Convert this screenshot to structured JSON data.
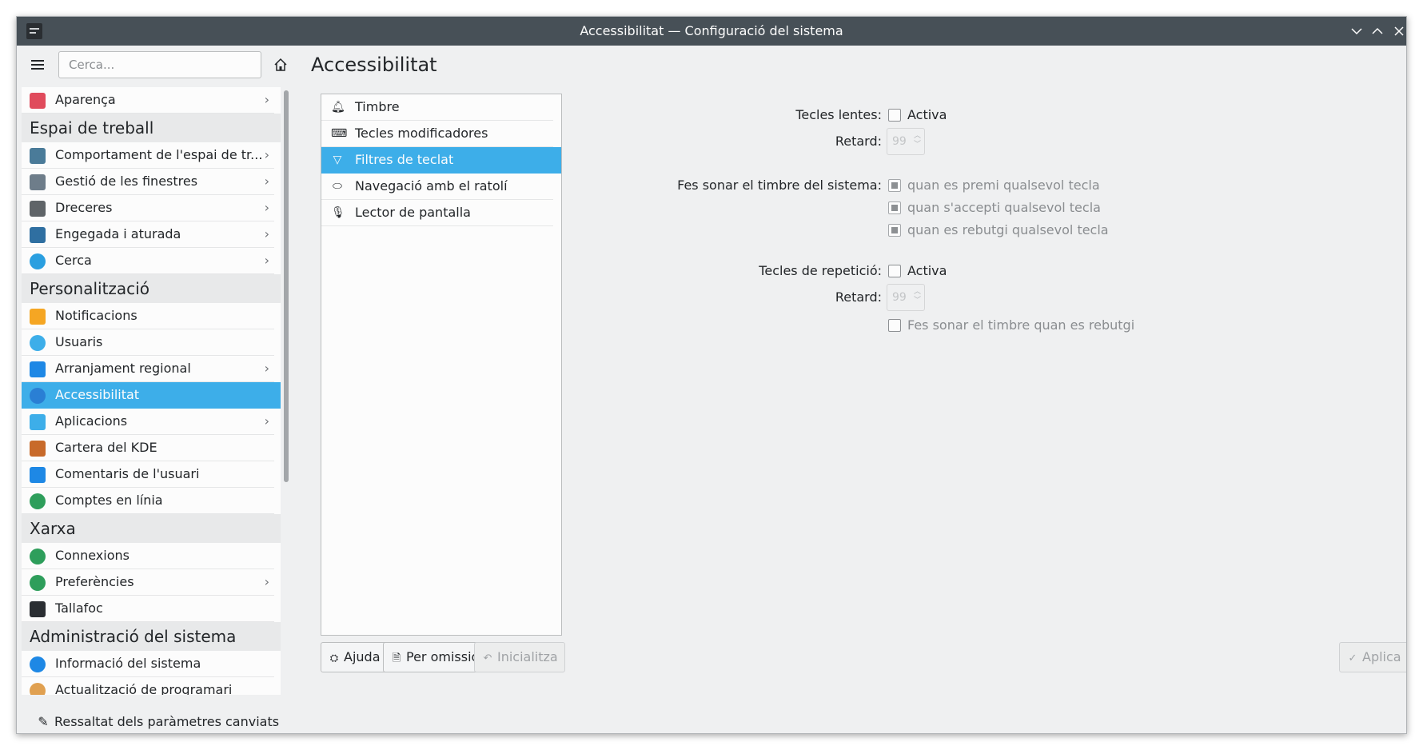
{
  "window": {
    "title": "Accessibilitat — Configuració del sistema",
    "controls": [
      "minimize",
      "maximize",
      "close"
    ]
  },
  "sidebar": {
    "search_placeholder": "Cerca...",
    "items": [
      {
        "label": "Aparença",
        "icon": "appearance-icon",
        "color": "#e04b5c",
        "chevron": true
      },
      {
        "header": "Espai de treball"
      },
      {
        "label": "Comportament de l'espai de tr...",
        "icon": "workspace-behavior-icon",
        "color": "#4a7b99",
        "chevron": true
      },
      {
        "label": "Gestió de les finestres",
        "icon": "window-management-icon",
        "color": "#6e7d8a",
        "chevron": true
      },
      {
        "label": "Dreceres",
        "icon": "keyboard-icon",
        "color": "#5f6468",
        "chevron": true
      },
      {
        "label": "Engegada i aturada",
        "icon": "startup-icon",
        "color": "#2f6fa1",
        "chevron": true
      },
      {
        "label": "Cerca",
        "icon": "search-icon",
        "color": "#2a9fe0",
        "chevron": true
      },
      {
        "header": "Personalització"
      },
      {
        "label": "Notificacions",
        "icon": "bell-icon",
        "color": "#f5a623",
        "chevron": false
      },
      {
        "label": "Usuaris",
        "icon": "users-icon",
        "color": "#3daee9",
        "chevron": false
      },
      {
        "label": "Arranjament regional",
        "icon": "regional-icon",
        "color": "#1e88e5",
        "chevron": true
      },
      {
        "label": "Accessibilitat",
        "icon": "accessibility-icon",
        "color": "#2a7fd4",
        "chevron": false,
        "selected": true
      },
      {
        "label": "Aplicacions",
        "icon": "applications-icon",
        "color": "#3daee9",
        "chevron": true
      },
      {
        "label": "Cartera del KDE",
        "icon": "wallet-icon",
        "color": "#c86a2a",
        "chevron": false
      },
      {
        "label": "Comentaris de l'usuari",
        "icon": "feedback-icon",
        "color": "#1e88e5",
        "chevron": false
      },
      {
        "label": "Comptes en línia",
        "icon": "online-accounts-icon",
        "color": "#2e9e5b",
        "chevron": false
      },
      {
        "header": "Xarxa"
      },
      {
        "label": "Connexions",
        "icon": "globe-icon",
        "color": "#2e9e5b",
        "chevron": false
      },
      {
        "label": "Preferències",
        "icon": "network-preferences-icon",
        "color": "#2e9e5b",
        "chevron": true
      },
      {
        "label": "Tallafoc",
        "icon": "firewall-icon",
        "color": "#2a2e32",
        "chevron": false
      },
      {
        "header": "Administració del sistema"
      },
      {
        "label": "Informació del sistema",
        "icon": "info-icon",
        "color": "#1e88e5",
        "chevron": false
      },
      {
        "label": "Actualització de programari",
        "icon": "update-icon",
        "color": "#e0a050",
        "chevron": false
      }
    ],
    "highlight_changed": "Ressaltat dels paràmetres canviats"
  },
  "main": {
    "title": "Accessibilitat",
    "categories": [
      {
        "label": "Timbre",
        "icon": "bell-outline-icon"
      },
      {
        "label": "Tecles modificadores",
        "icon": "keyboard-outline-icon"
      },
      {
        "label": "Filtres de teclat",
        "icon": "filter-icon",
        "selected": true
      },
      {
        "label": "Navegació amb el ratolí",
        "icon": "mouse-icon"
      },
      {
        "label": "Lector de pantalla",
        "icon": "microphone-icon"
      }
    ],
    "slow_keys": {
      "label": "Tecles lentes:",
      "enable": "Activa",
      "checked": false,
      "delay_label": "Retard:",
      "delay_value": "99"
    },
    "bell": {
      "label": "Fes sonar el timbre del sistema:",
      "options": [
        "quan es premi qualsevol tecla",
        "quan s'accepti qualsevol tecla",
        "quan es rebutgi qualsevol tecla"
      ]
    },
    "bounce_keys": {
      "label": "Tecles de repetició:",
      "enable": "Activa",
      "checked": false,
      "delay_label": "Retard:",
      "delay_value": "99",
      "reject_bell": "Fes sonar el timbre quan es rebutgi"
    },
    "buttons": {
      "help": "Ajuda",
      "defaults": "Per omissió",
      "reset": "Inicialitza",
      "apply": "Aplica"
    }
  }
}
